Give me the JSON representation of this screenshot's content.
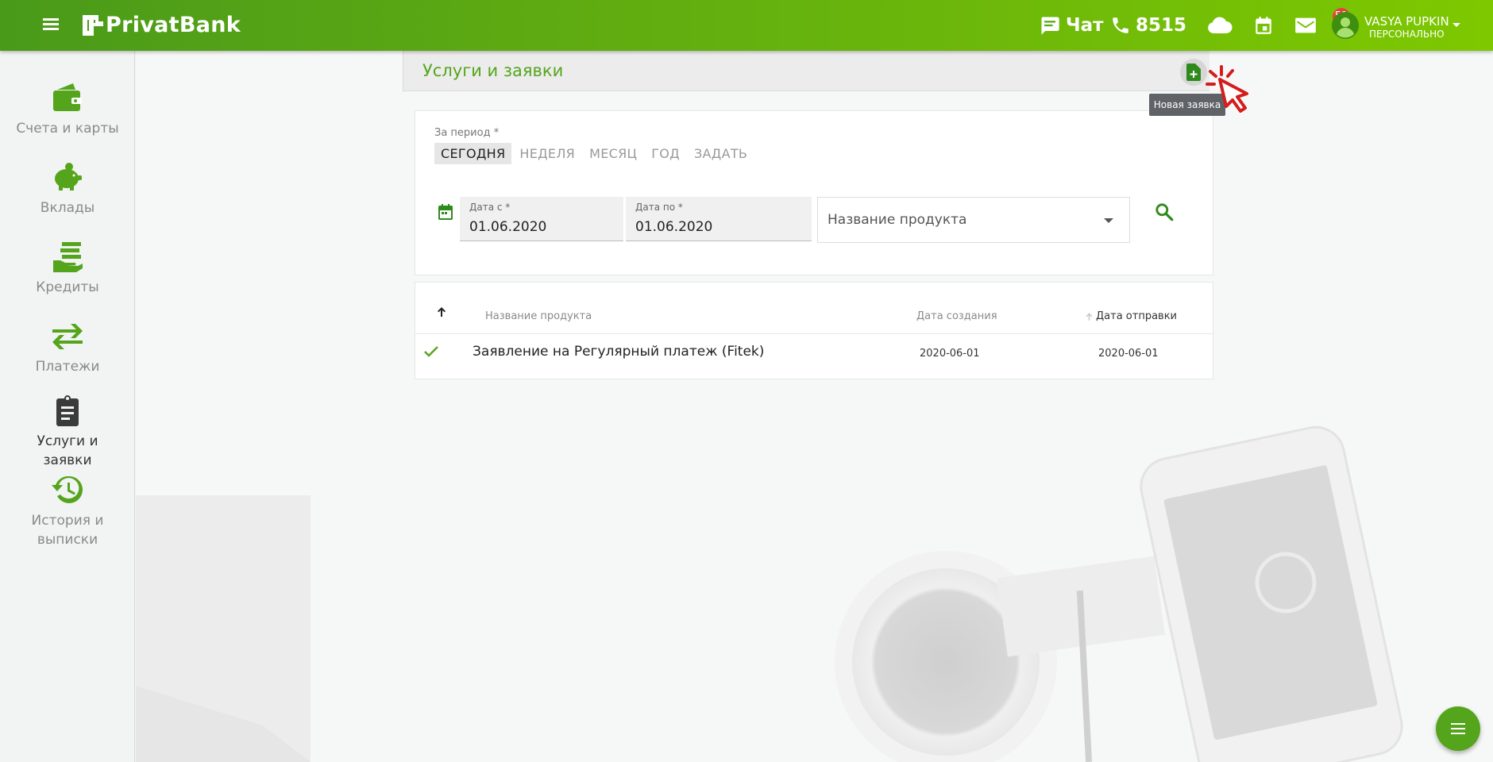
{
  "header": {
    "brand": "PrivatBank",
    "chat_label": "Чат",
    "phone_label": "8515",
    "mail_badge": "51",
    "user_name": "VASYA PUPKIN",
    "user_role": "ПЕРСОНАЛЬНО"
  },
  "sidebar": {
    "items": [
      {
        "label": "Счета и карты",
        "icon": "wallet-icon"
      },
      {
        "label": "Вклады",
        "icon": "piggy-bank-icon"
      },
      {
        "label": "Кредиты",
        "icon": "hand-money-icon"
      },
      {
        "label": "Платежи",
        "icon": "transfer-arrows-icon"
      },
      {
        "label_line1": "Услуги и",
        "label_line2": "заявки",
        "icon": "clipboard-icon",
        "active": true
      },
      {
        "label_line1": "История и",
        "label_line2": "выписки",
        "icon": "history-icon"
      }
    ]
  },
  "page": {
    "title": "Услуги и заявки",
    "new_request_tooltip": "Новая заявка"
  },
  "filter": {
    "period_label": "За период *",
    "period_tabs": [
      "СЕГОДНЯ",
      "НЕДЕЛЯ",
      "МЕСЯЦ",
      "ГОД",
      "ЗАДАТЬ"
    ],
    "active_tab": "СЕГОДНЯ",
    "date_from_label": "Дата с *",
    "date_from_value": "01.06.2020",
    "date_to_label": "Дата по *",
    "date_to_value": "01.06.2020",
    "product_placeholder": "Название продукта"
  },
  "table": {
    "columns": [
      "Название продукта",
      "Дата создания",
      "Дата отправки"
    ],
    "rows": [
      {
        "product": "Заявление на Регулярный платеж (Fitek)",
        "created": "2020-06-01",
        "sent": "2020-06-01",
        "status": "check-icon"
      }
    ]
  },
  "colors": {
    "brand_green": "#55a51c",
    "header_gradient_start": "#4a9a1a",
    "header_gradient_end": "#7ec800",
    "badge_red": "#e5423c"
  }
}
